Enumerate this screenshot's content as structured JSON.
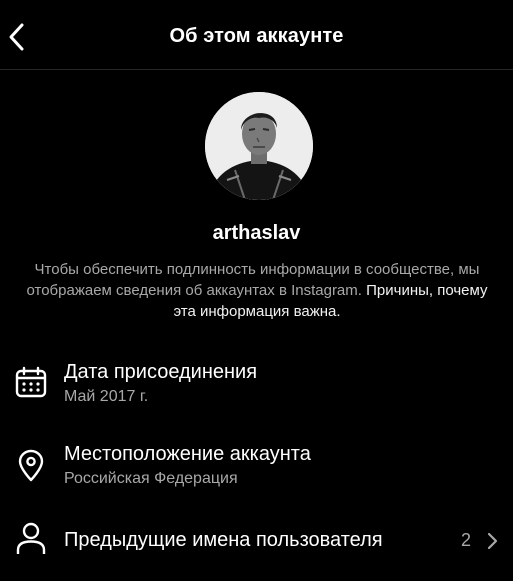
{
  "header": {
    "title": "Об этом аккаунте",
    "back_icon": "chevron-left-icon"
  },
  "profile": {
    "username": "arthaslav",
    "avatar_icon": "profile-photo"
  },
  "description": {
    "text": "Чтобы обеспечить подлинность информации в сообществе, мы отображаем сведения об аккаунтах в Instagram.",
    "link": "Причины, почему эта информация важна."
  },
  "rows": {
    "date_joined": {
      "icon": "calendar-icon",
      "title": "Дата присоединения",
      "value": "Май 2017 г."
    },
    "location": {
      "icon": "location-pin-icon",
      "title": "Местоположение аккаунта",
      "value": "Российская Федерация"
    },
    "former_usernames": {
      "icon": "user-icon",
      "title": "Предыдущие имена пользователя",
      "count": "2",
      "chevron_icon": "chevron-right-icon"
    }
  },
  "colors": {
    "background": "#000000",
    "text_primary": "#ffffff",
    "text_secondary": "#a8a8a8",
    "divider": "#262626"
  }
}
